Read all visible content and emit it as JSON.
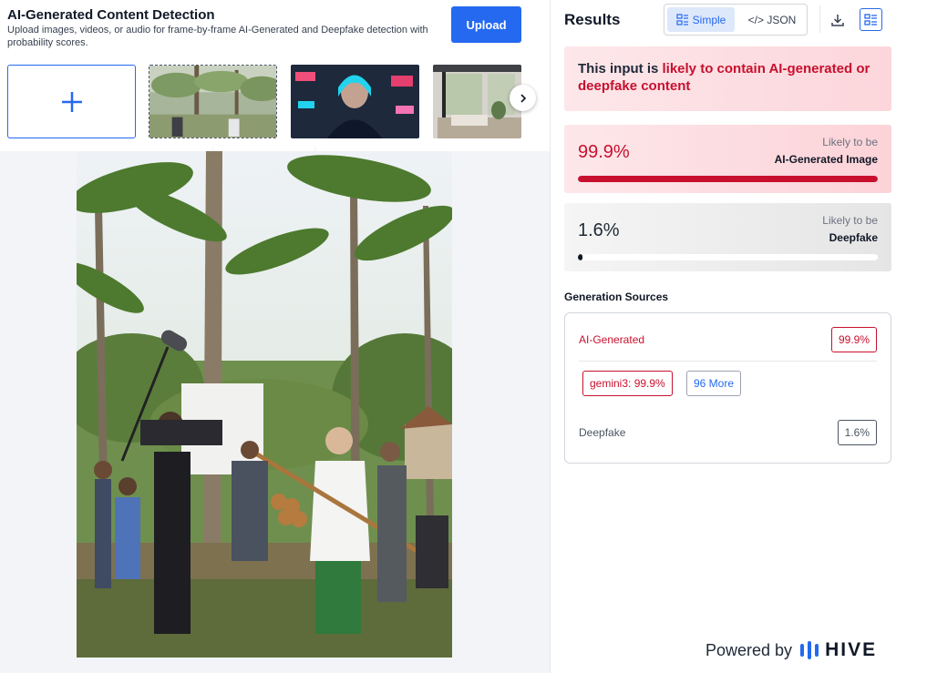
{
  "app": {
    "title": "AI-Generated Content Detection",
    "description": "Upload images, videos, or audio for frame-by-frame AI-Generated and Deepfake detection with probability scores.",
    "upload_label": "Upload"
  },
  "gallery": {
    "add_icon": "plus-icon",
    "next_icon": "chevron-right-icon",
    "collapse_icon": "chevron-up-icon"
  },
  "results": {
    "title": "Results",
    "view_simple": "Simple",
    "view_json": "</> JSON",
    "download_icon": "download-icon",
    "list_icon": "list-view-icon",
    "verdict_prefix": "This input is ",
    "verdict_highlight": "likely to contain AI-generated or deepfake content",
    "ai_score": {
      "value": "99.9%",
      "fraction": 0.999,
      "likely_label": "Likely to be",
      "type_label": "AI-Generated Image"
    },
    "deepfake_score": {
      "value": "1.6%",
      "fraction": 0.016,
      "likely_label": "Likely to be",
      "type_label": "Deepfake"
    }
  },
  "sources": {
    "title": "Generation Sources",
    "ai_label": "AI-Generated",
    "ai_value": "99.9%",
    "model_tag": "gemini3: 99.9%",
    "more_tag": "96 More",
    "deepfake_label": "Deepfake",
    "deepfake_value": "1.6%"
  },
  "footer": {
    "powered_by": "Powered by",
    "brand": "HIVE"
  },
  "colors": {
    "accent_blue": "#2469f0",
    "alert_red": "#c8102e"
  }
}
